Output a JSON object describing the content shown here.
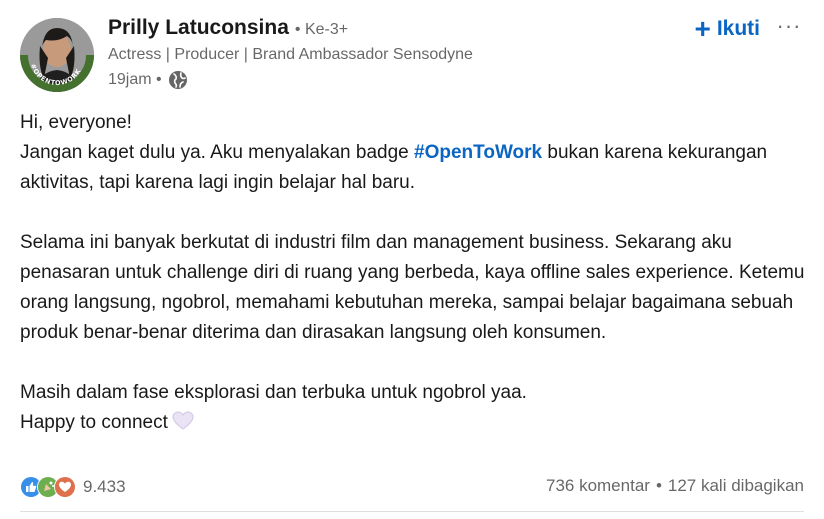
{
  "post": {
    "author": {
      "name": "Prilly Latuconsina",
      "degree": "• Ke-3+",
      "headline": "Actress | Producer | Brand Ambassador Sensodyne",
      "time": "19jam •",
      "avatar_badge": "#OPENTOWORK"
    },
    "actions": {
      "follow_label": "Ikuti",
      "more_label": "···"
    },
    "body": {
      "line1": "Hi, everyone!",
      "line2_before": "Jangan kaget dulu ya. Aku menyalakan badge ",
      "hashtag": "#OpenToWork",
      "line2_after": " bukan karena kekurangan aktivitas, tapi karena lagi ingin belajar hal baru.",
      "paragraph2": "Selama ini banyak berkutat di industri film dan management business. Sekarang aku penasaran untuk challenge diri di ruang yang berbeda, kaya offline sales experience. Ketemu orang langsung, ngobrol, memahami kebutuhan mereka, sampai belajar bagaimana sebuah produk benar-benar diterima dan dirasakan langsung oleh konsumen.",
      "line_last1": "Masih dalam fase eksplorasi dan terbuka untuk ngobrol yaa.",
      "line_last2": "Happy to connect"
    },
    "social": {
      "reactions_count": "9.433",
      "comments": "736 komentar",
      "separator": "•",
      "shares": "127 kali dibagikan",
      "reaction_icons": [
        "like-icon",
        "celebrate-icon",
        "love-icon"
      ]
    },
    "colors": {
      "link_blue": "#0a66c2",
      "text_secondary": "#666666",
      "opentowork_green": "#44712e"
    }
  }
}
